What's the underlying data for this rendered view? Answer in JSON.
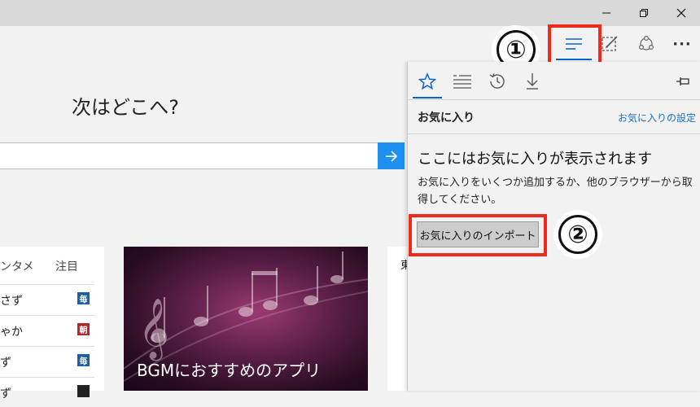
{
  "window": {
    "controls": {
      "minimize_icon": "minimize-icon",
      "restore_icon": "restore-icon",
      "close_icon": "close-icon"
    }
  },
  "toolbar": {
    "hub_icon": "hub-icon",
    "web_note_icon": "web-note-icon",
    "share_icon": "share-icon",
    "more_label": "···",
    "highlight_color": "#f0291b"
  },
  "annotations": {
    "step1": "①",
    "step2": "②"
  },
  "page": {
    "headline": "次はどこへ?",
    "search": {
      "value": "",
      "go_icon": "arrow-right-icon"
    },
    "news": {
      "tab_entertainment": "ンタメ",
      "tab_featured": "注目",
      "rows": [
        {
          "text": "さず",
          "badge": "毎",
          "badge_color": "#1a5fa8"
        },
        {
          "text": "ゃか",
          "badge": "朝",
          "badge_color": "#b2282d"
        },
        {
          "text": "ず",
          "badge": "毎",
          "badge_color": "#1a5fa8"
        },
        {
          "text": "ず",
          "badge": "",
          "badge_color": "#222222"
        }
      ]
    },
    "feature_card": {
      "caption": "BGMにおすすめのアプリ"
    },
    "right_card": {
      "text": "東"
    }
  },
  "hub_panel": {
    "tabs": [
      "favorites",
      "reading-list",
      "history",
      "downloads"
    ],
    "pin_icon": "pin-icon",
    "title": "お気に入り",
    "settings_link": "お気に入りの設定",
    "empty_heading": "ここにはお気に入りが表示されます",
    "empty_body": "お気に入りをいくつか追加するか、他のブラウザーから取得してください。",
    "import_button": "お気に入りのインポート",
    "accent": "#0a64c8"
  }
}
